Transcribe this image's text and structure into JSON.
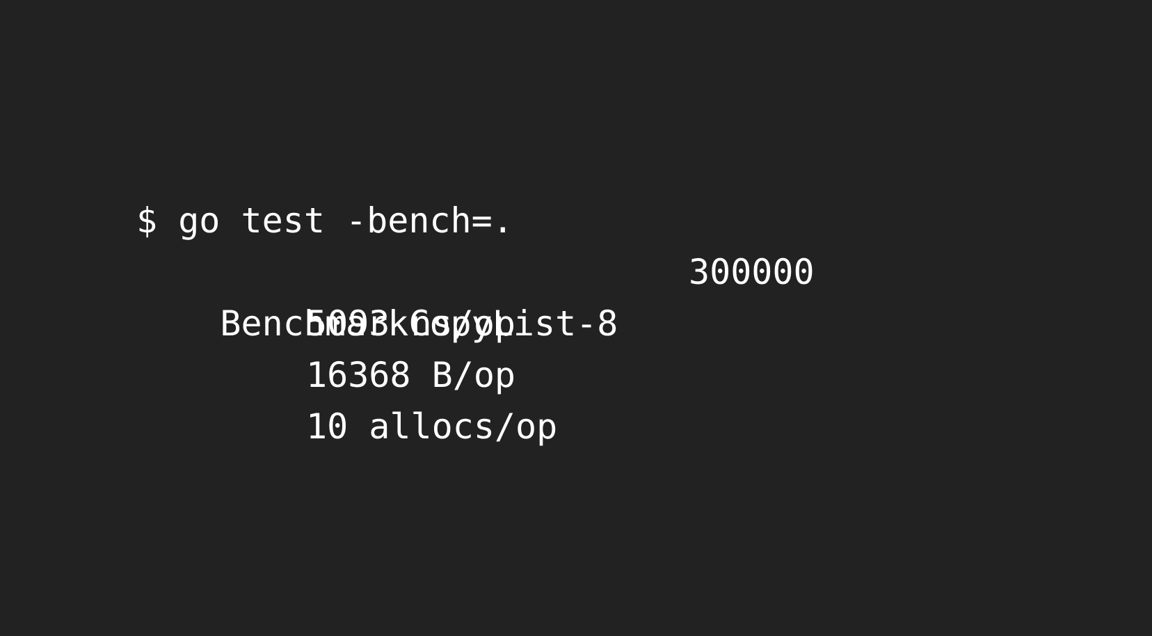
{
  "terminal": {
    "background_color": "#222222",
    "text_color": "#ffffff",
    "command": "$ go test -bench=.",
    "benchmark": {
      "name": "BenchmarkCopyList-8",
      "iterations": "300000",
      "ns_per_op": "5093 ns/op",
      "bytes_per_op": "16368 B/op",
      "allocs_per_op": "10 allocs/op"
    }
  }
}
